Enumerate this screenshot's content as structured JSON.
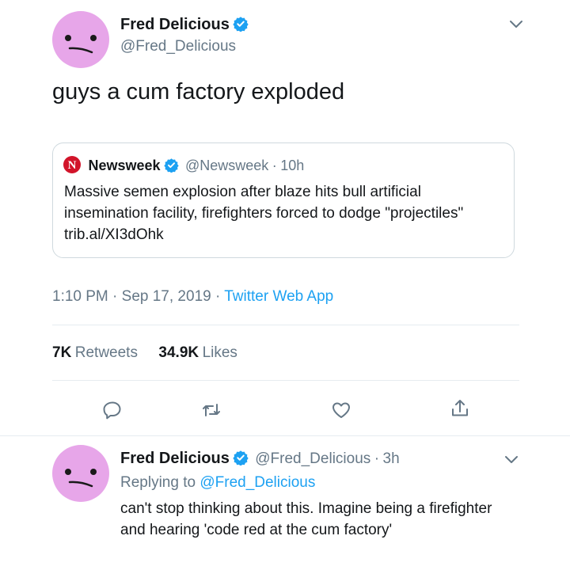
{
  "main_tweet": {
    "author_name": "Fred Delicious",
    "author_handle": "@Fred_Delicious",
    "text": "guys a cum factory exploded",
    "verified": true,
    "quoted": {
      "source_logo_letter": "N",
      "author_name": "Newsweek",
      "author_handle": "@Newsweek",
      "separator": "·",
      "age": "10h",
      "text": "Massive semen explosion after blaze hits bull artificial insemination facility, firefighters forced to dodge \"projectiles\" trib.al/XI3dOhk"
    },
    "time": "1:10 PM",
    "date": "Sep 17, 2019",
    "app": "Twitter Web App",
    "retweets_count": "7K",
    "retweets_label": "Retweets",
    "likes_count": "34.9K",
    "likes_label": "Likes"
  },
  "reply_tweet": {
    "author_name": "Fred Delicious",
    "author_handle": "@Fred_Delicious",
    "separator": "·",
    "age": "3h",
    "replying_prefix": "Replying to",
    "replying_to": "@Fred_Delicious",
    "text": "can't stop thinking about this. Imagine being a firefighter and hearing 'code red at the cum factory'"
  },
  "colors": {
    "accent": "#1da1f2",
    "avatar_bg": "#e7a6e9",
    "newsweek_red": "#d2142a",
    "muted": "#657786"
  },
  "icons": [
    "verified-badge-icon",
    "chevron-down-icon",
    "reply-icon",
    "retweet-icon",
    "like-icon",
    "share-icon",
    "newsweek-logo-icon"
  ]
}
